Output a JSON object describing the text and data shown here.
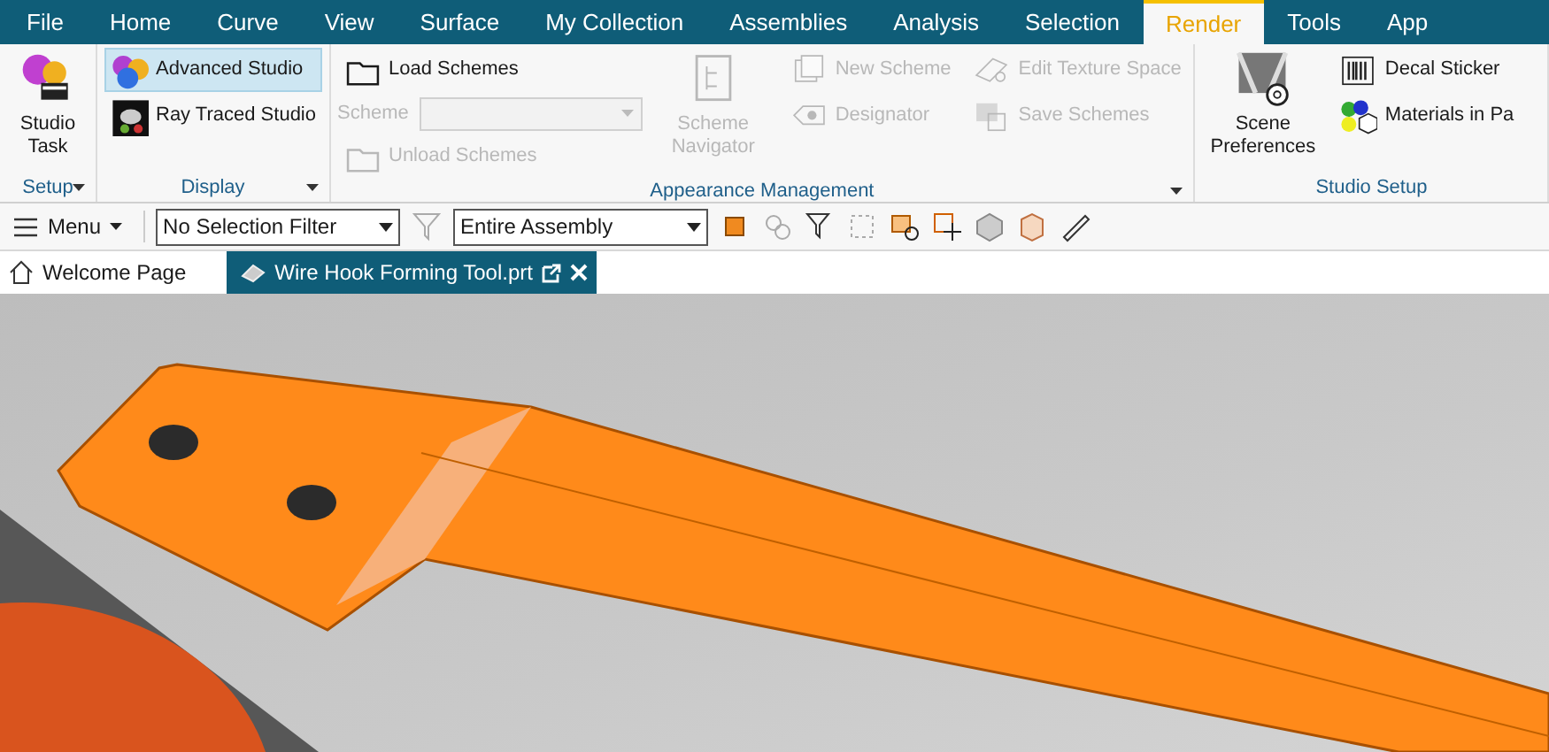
{
  "menu_tabs": [
    {
      "label": "File",
      "selected": false
    },
    {
      "label": "Home",
      "selected": false
    },
    {
      "label": "Curve",
      "selected": false
    },
    {
      "label": "View",
      "selected": false
    },
    {
      "label": "Surface",
      "selected": false
    },
    {
      "label": "My Collection",
      "selected": false
    },
    {
      "label": "Assemblies",
      "selected": false
    },
    {
      "label": "Analysis",
      "selected": false
    },
    {
      "label": "Selection",
      "selected": false
    },
    {
      "label": "Render",
      "selected": true
    },
    {
      "label": "Tools",
      "selected": false
    },
    {
      "label": "App",
      "selected": false
    }
  ],
  "ribbon_groups": [
    {
      "title": "Setup",
      "has_launcher": true,
      "columns": [
        [
          {
            "kind": "large",
            "label": "Studio Task",
            "disabled": false
          }
        ]
      ]
    },
    {
      "title": "Display",
      "has_launcher": true,
      "columns": [
        [
          {
            "kind": "small",
            "label": "Advanced Studio",
            "disabled": false,
            "selected": true
          },
          {
            "kind": "small",
            "label": "Ray Traced Studio",
            "disabled": false,
            "selected": false
          }
        ]
      ]
    },
    {
      "title": "Appearance Management",
      "has_launcher": true,
      "columns": [
        [
          {
            "kind": "small",
            "label": "Load Schemes",
            "disabled": false
          },
          {
            "kind": "combo",
            "label": "Scheme",
            "disabled": true
          },
          {
            "kind": "small",
            "label": "Unload Schemes",
            "disabled": true
          }
        ],
        [
          {
            "kind": "large",
            "label": "Scheme Navigator",
            "disabled": true
          }
        ],
        [
          {
            "kind": "small",
            "label": "New Scheme",
            "disabled": true
          },
          {
            "kind": "small",
            "label": "Designator",
            "disabled": true
          }
        ],
        [
          {
            "kind": "small",
            "label": "Edit Texture Space",
            "disabled": true
          },
          {
            "kind": "small",
            "label": "Save Schemes",
            "disabled": true
          }
        ]
      ]
    },
    {
      "title": "Studio Setup",
      "has_launcher": false,
      "columns": [
        [
          {
            "kind": "large",
            "label": "Scene Preferences",
            "disabled": false
          }
        ],
        [
          {
            "kind": "small",
            "label": "Decal Sticker",
            "disabled": false
          },
          {
            "kind": "small",
            "label": "Materials in Pa",
            "disabled": false
          }
        ]
      ]
    }
  ],
  "toolbar": {
    "menu_label": "Menu",
    "selection_filter": "No Selection Filter",
    "scope": "Entire Assembly"
  },
  "doc_tabs": [
    {
      "label": "Welcome Page",
      "selected": false
    },
    {
      "label": "Wire Hook Forming Tool.prt",
      "selected": true
    }
  ]
}
